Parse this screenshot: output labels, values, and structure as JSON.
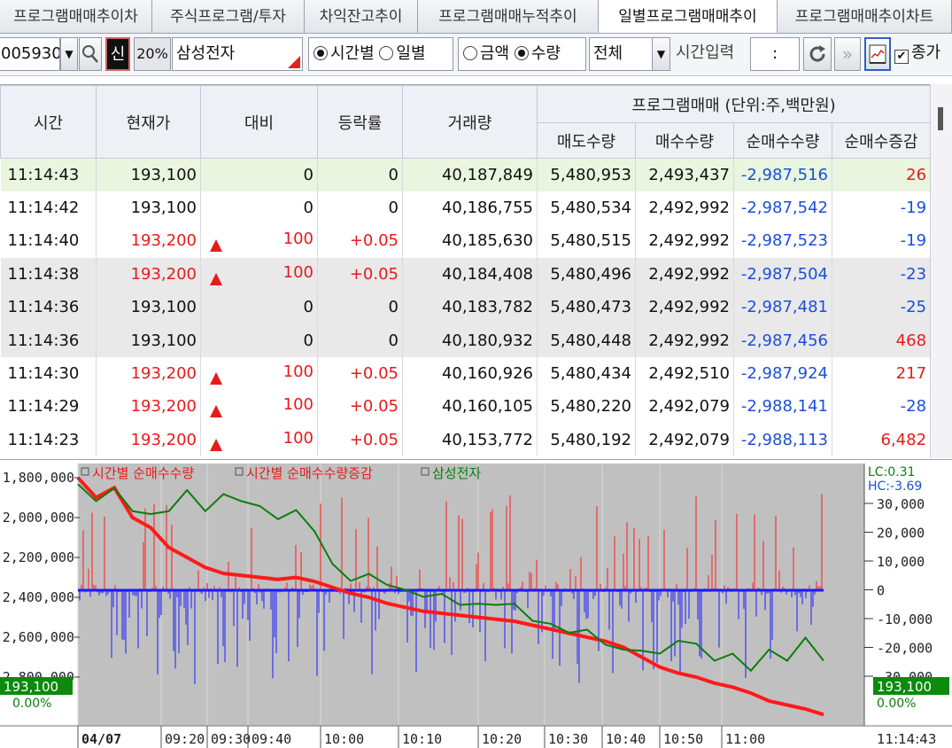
{
  "tabs": [
    {
      "label": "프로그램매매추이차"
    },
    {
      "label": "주식프로그램/투자"
    },
    {
      "label": "차익잔고추이"
    },
    {
      "label": "프로그램매매누적추이"
    },
    {
      "label": "일별프로그램매매추이"
    },
    {
      "label": "프로그램매매추이차트"
    }
  ],
  "active_tab_index": 4,
  "toolbar": {
    "code": "005930",
    "search_icon": "search-icon",
    "credit_badge": "신",
    "margin_rate": "20%",
    "stock_name": "삼성전자",
    "radio_time": "시간별",
    "radio_day": "일별",
    "radio_amount": "금액",
    "radio_qty": "수량",
    "market_select": "전체",
    "time_input_label": "시간입력",
    "time_input_value": ":",
    "refresh_icon": "refresh-icon",
    "next_icon": "double-chevron-right-icon",
    "chart_icon": "chart-icon",
    "close_price_label": "종가",
    "close_price_checked": true
  },
  "table": {
    "headers": {
      "time": "시간",
      "price": "현재가",
      "change": "대비",
      "rate": "등락률",
      "volume": "거래량",
      "program_group": "프로그램매매 (단위:주,백만원)",
      "sell_qty": "매도수량",
      "buy_qty": "매수수량",
      "net_qty": "순매수수량",
      "net_change": "순매수증감"
    },
    "rows": [
      {
        "time": "11:14:43",
        "price": "193,100",
        "up": false,
        "change": "0",
        "rate": "0",
        "volume": "40,187,849",
        "sell": "5,480,953",
        "buy": "2,493,437",
        "net": "-2,987,516",
        "delta": "26",
        "delta_up": true
      },
      {
        "time": "11:14:42",
        "price": "193,100",
        "up": false,
        "change": "0",
        "rate": "0",
        "volume": "40,186,755",
        "sell": "5,480,534",
        "buy": "2,492,992",
        "net": "-2,987,542",
        "delta": "-19",
        "delta_up": false
      },
      {
        "time": "11:14:40",
        "price": "193,200",
        "up": true,
        "change": "100",
        "rate": "+0.05",
        "volume": "40,185,630",
        "sell": "5,480,515",
        "buy": "2,492,992",
        "net": "-2,987,523",
        "delta": "-19",
        "delta_up": false
      },
      {
        "time": "11:14:38",
        "price": "193,200",
        "up": true,
        "change": "100",
        "rate": "+0.05",
        "volume": "40,184,408",
        "sell": "5,480,496",
        "buy": "2,492,992",
        "net": "-2,987,504",
        "delta": "-23",
        "delta_up": false
      },
      {
        "time": "11:14:36",
        "price": "193,100",
        "up": false,
        "change": "0",
        "rate": "0",
        "volume": "40,183,782",
        "sell": "5,480,473",
        "buy": "2,492,992",
        "net": "-2,987,481",
        "delta": "-25",
        "delta_up": false
      },
      {
        "time": "11:14:36",
        "price": "193,100",
        "up": false,
        "change": "0",
        "rate": "0",
        "volume": "40,180,932",
        "sell": "5,480,448",
        "buy": "2,492,992",
        "net": "-2,987,456",
        "delta": "468",
        "delta_up": true
      },
      {
        "time": "11:14:30",
        "price": "193,200",
        "up": true,
        "change": "100",
        "rate": "+0.05",
        "volume": "40,160,926",
        "sell": "5,480,434",
        "buy": "2,492,510",
        "net": "-2,987,924",
        "delta": "217",
        "delta_up": true
      },
      {
        "time": "11:14:29",
        "price": "193,200",
        "up": true,
        "change": "100",
        "rate": "+0.05",
        "volume": "40,160,105",
        "sell": "5,480,220",
        "buy": "2,492,079",
        "net": "-2,988,141",
        "delta": "-28",
        "delta_up": false
      },
      {
        "time": "11:14:23",
        "price": "193,200",
        "up": true,
        "change": "100",
        "rate": "+0.05",
        "volume": "40,153,772",
        "sell": "5,480,192",
        "buy": "2,492,079",
        "net": "-2,988,113",
        "delta": "6,482",
        "delta_up": true
      }
    ]
  },
  "chart_data": {
    "type": "line",
    "legend": [
      "시간별 순매수수량",
      "시간별 순매수수량증감",
      "삼성전자"
    ],
    "series_colors": {
      "net_qty": "#ff1a1a",
      "net_change_up": "#ff1a1a",
      "net_change_down": "#1a1aff",
      "price": "#0b7d0b"
    },
    "left_axis_ticks": [
      "1,800,000",
      "2,000,000",
      "2,200,000",
      "2,400,000",
      "2,600,000",
      "2,800,000"
    ],
    "right_axis_ticks": [
      "30,000",
      "20,000",
      "10,000",
      "0",
      "-10,000",
      "-20,000",
      "-30,000"
    ],
    "right_info": {
      "lc": "LC:0.31",
      "hc": "HC:-3.69"
    },
    "price_tag": "193,100",
    "rate_tag": "0.00%",
    "x_labels": [
      "04/07",
      "09:20",
      "09:30",
      "09:40",
      "10:00",
      "10:10",
      "10:20",
      "10:30",
      "10:40",
      "10:50",
      "11:00"
    ],
    "current_time": "11:14:43",
    "net_qty_series": [
      -1800000,
      -1900000,
      -1850000,
      -2000000,
      -2050000,
      -2150000,
      -2200000,
      -2250000,
      -2280000,
      -2290000,
      -2300000,
      -2310000,
      -2300000,
      -2320000,
      -2350000,
      -2380000,
      -2400000,
      -2430000,
      -2450000,
      -2470000,
      -2480000,
      -2490000,
      -2500000,
      -2510000,
      -2520000,
      -2540000,
      -2560000,
      -2580000,
      -2600000,
      -2620000,
      -2650000,
      -2700000,
      -2750000,
      -2780000,
      -2800000,
      -2830000,
      -2850000,
      -2880000,
      -2920000,
      -2940000,
      -2960000,
      -2988000
    ],
    "price_index_series": [
      1850000,
      1900000,
      1870000,
      1950000,
      2000000,
      1950000,
      1880000,
      1950000,
      1900000,
      1900000,
      1960000,
      1990000,
      1980000,
      2050000,
      2250000,
      2300000,
      2300000,
      2320000,
      2380000,
      2380000,
      2400000,
      2420000,
      2450000,
      2420000,
      2450000,
      2500000,
      2550000,
      2560000,
      2580000,
      2620000,
      2680000,
      2650000,
      2700000,
      2600000,
      2650000,
      2700000,
      2700000,
      2750000,
      2680000,
      2700000,
      2620000,
      2700000
    ]
  }
}
